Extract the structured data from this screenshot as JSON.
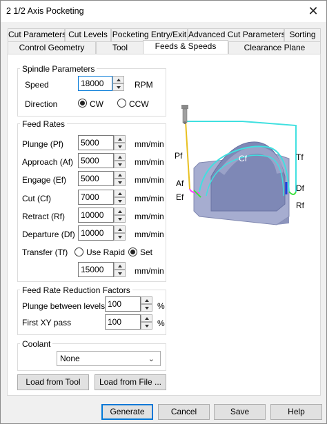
{
  "window": {
    "title": "2 1/2 Axis Pocketing",
    "close_glyph": "✕"
  },
  "tabs_row1": [
    "Cut Parameters",
    "Cut Levels",
    "Pocketing Entry/Exit",
    "Advanced Cut Parameters",
    "Sorting"
  ],
  "tabs_row2": [
    "Control Geometry",
    "Tool",
    "Feeds & Speeds",
    "Clearance Plane"
  ],
  "active_tab": "Feeds & Speeds",
  "spindle": {
    "group_label": "Spindle Parameters",
    "speed_label": "Speed",
    "speed_value": "18000",
    "speed_unit": "RPM",
    "direction_label": "Direction",
    "cw_label": "CW",
    "ccw_label": "CCW",
    "direction_selected": "CW"
  },
  "feed_rates": {
    "group_label": "Feed Rates",
    "unit": "mm/min",
    "rows": [
      {
        "label": "Plunge (Pf)",
        "value": "5000"
      },
      {
        "label": "Approach (Af)",
        "value": "5000"
      },
      {
        "label": "Engage (Ef)",
        "value": "5000"
      },
      {
        "label": "Cut (Cf)",
        "value": "7000"
      },
      {
        "label": "Retract (Rf)",
        "value": "10000"
      },
      {
        "label": "Departure  (Df)",
        "value": "10000"
      }
    ],
    "transfer_label": "Transfer (Tf)",
    "use_rapid_label": "Use Rapid",
    "set_label": "Set",
    "transfer_selected": "Set",
    "transfer_value": "15000",
    "transfer_unit": "mm/min"
  },
  "reduction": {
    "group_label": "Feed Rate Reduction Factors",
    "plunge_label": "Plunge between levels",
    "plunge_value": "100",
    "first_label": "First XY pass",
    "first_value": "100",
    "unit": "%"
  },
  "coolant": {
    "group_label": "Coolant",
    "selected": "None"
  },
  "buttons": {
    "load_tool": "Load from Tool",
    "load_file": "Load from File ...",
    "generate": "Generate",
    "cancel": "Cancel",
    "save": "Save",
    "help": "Help"
  },
  "diagram": {
    "labels": {
      "pf": "Pf",
      "cf": "Cf",
      "tf": "Tf",
      "af": "Af",
      "ef": "Ef",
      "df": "Df",
      "rf": "Rf"
    },
    "colors": {
      "plunge": "#e8c020",
      "cut": "#40e0e0",
      "transfer": "#40e0e0",
      "approach": "#ff40ff",
      "engage": "#40e040",
      "retract": "#2040e0",
      "block": "#9aa2c8"
    }
  }
}
